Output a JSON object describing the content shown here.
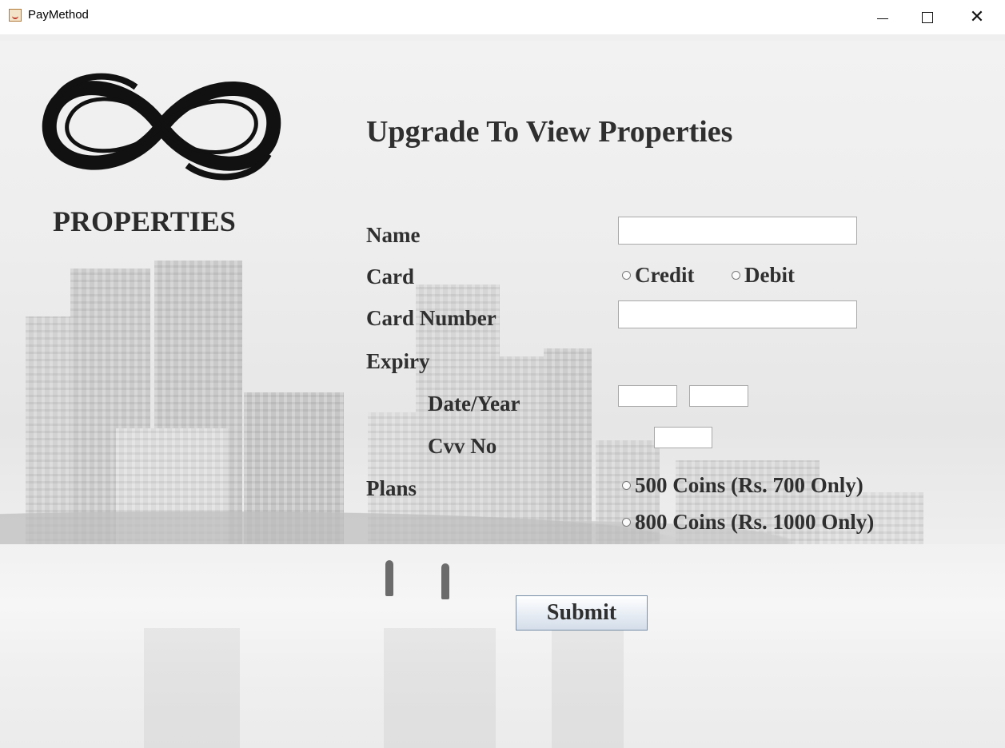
{
  "window": {
    "title": "PayMethod",
    "icon": "java-cup-icon",
    "controls": [
      "minimize",
      "maximize",
      "close"
    ]
  },
  "brand": {
    "logo_icon": "infinity-logo-icon",
    "name": "PROPERTIES"
  },
  "form": {
    "heading": "Upgrade To View Properties",
    "labels": {
      "name": "Name",
      "card": "Card",
      "card_number": "Card Number",
      "expiry": "Expiry",
      "date_year": "Date/Year",
      "cvv": "Cvv No",
      "plans": "Plans"
    },
    "fields": {
      "name": "",
      "card_number": "",
      "expiry_month": "",
      "expiry_year": "",
      "cvv": ""
    },
    "card_options": [
      "Credit",
      "Debit"
    ],
    "plan_options": [
      "500 Coins (Rs. 700 Only)",
      "800 Coins (Rs. 1000 Only)"
    ],
    "submit_label": "Submit"
  }
}
